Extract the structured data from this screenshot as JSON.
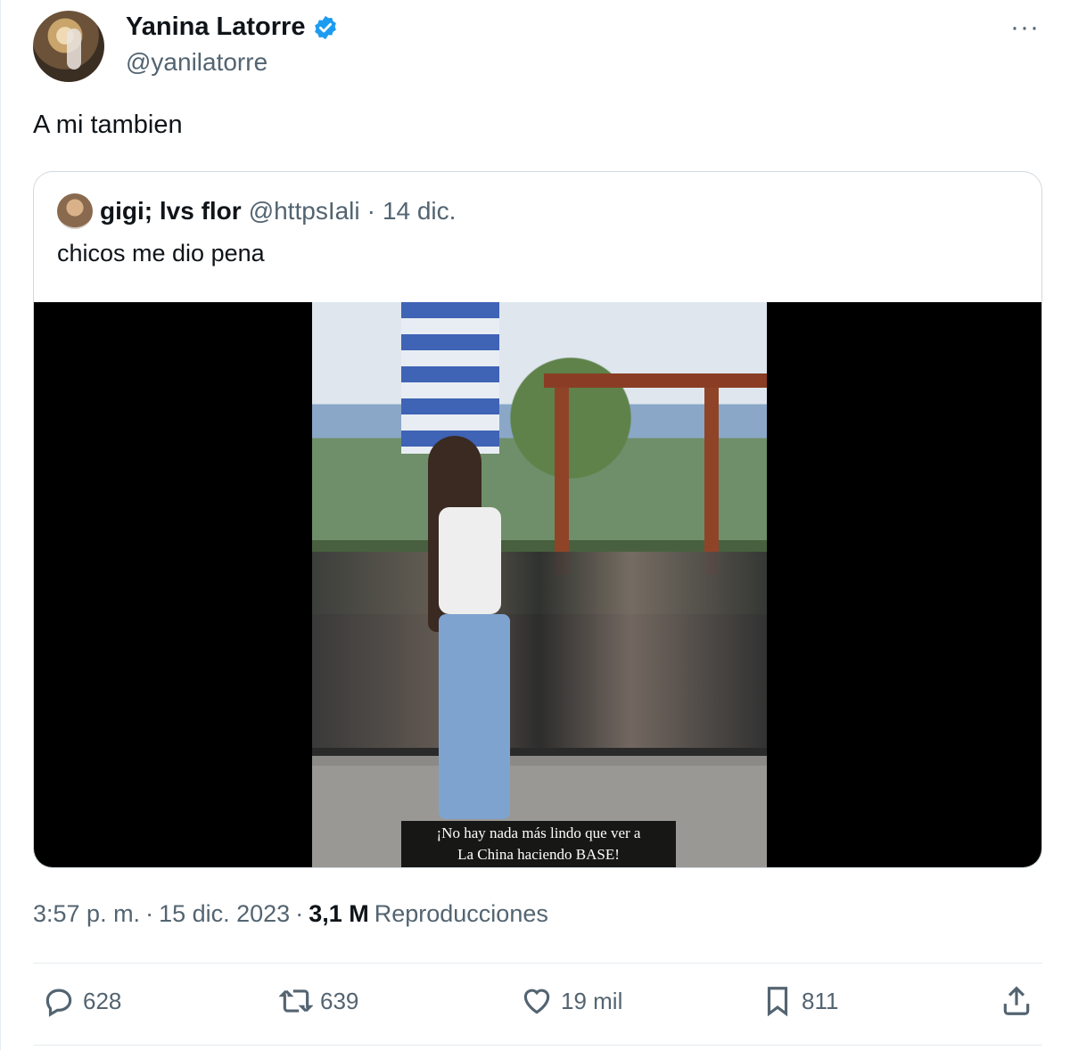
{
  "author": {
    "name": "Yanina Latorre",
    "handle": "@yanilatorre",
    "verified_color": "#1d9bf0"
  },
  "more_label": "···",
  "tweet_text": "A mi tambien",
  "quoted": {
    "name": "gigi; lvs flor",
    "handle": "@httpsIali",
    "dot": "·",
    "date": "14 dic.",
    "text": "chicos me dio pena",
    "video_caption_line1": "¡No hay nada más lindo que ver a",
    "video_caption_line2": "La China haciendo BASE!"
  },
  "meta": {
    "time": "3:57 p. m.",
    "dot1": "·",
    "date": "15 dic. 2023",
    "dot2": "·",
    "views_count": "3,1 M",
    "views_label": "Reproducciones"
  },
  "actions": {
    "replies": "628",
    "retweets": "639",
    "likes": "19 mil",
    "bookmarks": "811"
  },
  "icons": [
    "verified-icon",
    "more-icon",
    "reply-icon",
    "retweet-icon",
    "like-icon",
    "bookmark-icon",
    "share-icon"
  ]
}
